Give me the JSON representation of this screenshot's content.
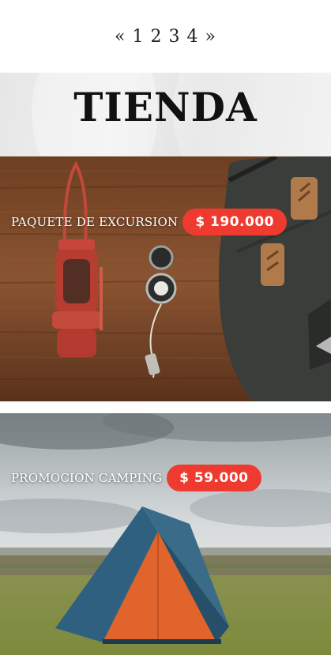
{
  "pagination": {
    "prev": "«",
    "pages": [
      "1",
      "2",
      "3",
      "4"
    ],
    "next": "»"
  },
  "hero": {
    "title": "TIENDA"
  },
  "products": [
    {
      "name": "PAQUETE DE EXCURSION",
      "price": "$ 190.000",
      "image_icon": "lantern-compass-backpack-photo"
    },
    {
      "name": "PROMOCION CAMPING",
      "price": "$ 59.000",
      "image_icon": "tent-landscape-photo"
    }
  ],
  "colors": {
    "price_badge": "#ef3b2f",
    "wood": "#7a4a2b",
    "tent_orange": "#e0642b",
    "tent_blue": "#2f6080"
  }
}
